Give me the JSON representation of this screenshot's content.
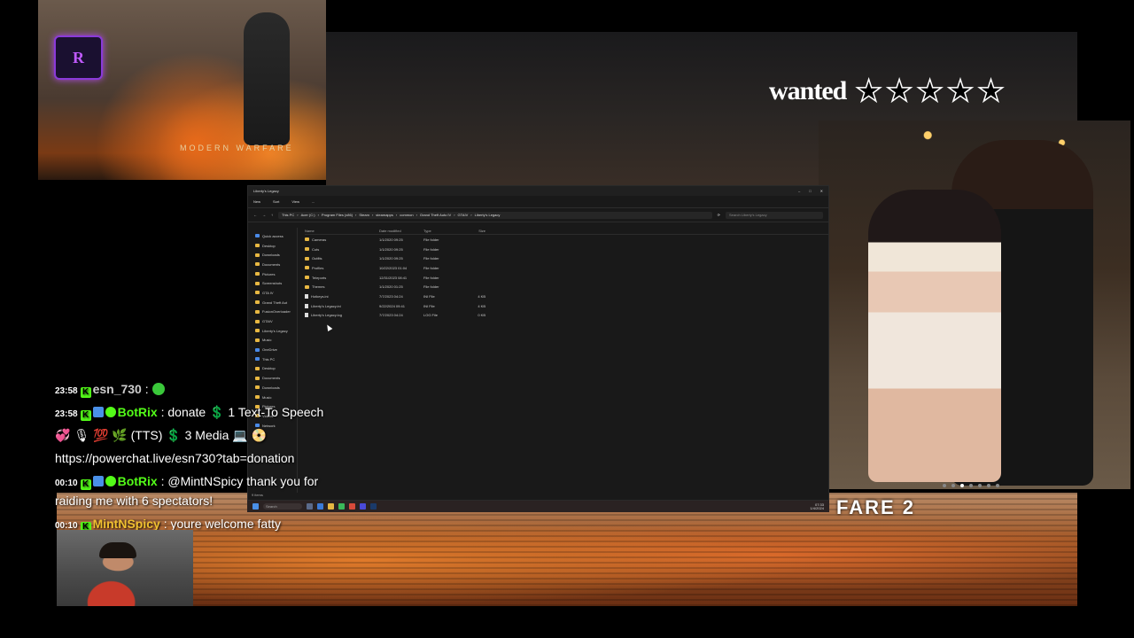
{
  "overlay": {
    "channel_logo_text": "R",
    "game_caption": "MODERN WARFARE",
    "mw_logo_text": "FARE 2",
    "wanted": {
      "label": "wanted",
      "stars_total": 5,
      "stars_lit": 0,
      "star_glyph": "★",
      "star_color": "#000000",
      "star_outline": "#ffffff"
    }
  },
  "explorer": {
    "title": "Liberty's Legacy",
    "toolbar": [
      "New",
      "Sort",
      "View",
      "..."
    ],
    "breadcrumb": [
      "This PC",
      "Acer (C:)",
      "Program Files (x86)",
      "Steam",
      "steamapps",
      "common",
      "Grand Theft Auto IV",
      "GTAIV",
      "Liberty's Legacy"
    ],
    "search_placeholder": "Search Liberty's Legacy",
    "nav": [
      {
        "label": "Quick access",
        "icon": "star-icon"
      },
      {
        "label": "Desktop",
        "icon": "folder-icon"
      },
      {
        "label": "Downloads",
        "icon": "folder-icon"
      },
      {
        "label": "Documents",
        "icon": "folder-icon"
      },
      {
        "label": "Pictures",
        "icon": "folder-icon"
      },
      {
        "label": "Screenshots",
        "icon": "folder-icon"
      },
      {
        "label": "GTA IV",
        "icon": "folder-icon"
      },
      {
        "label": "Grand Theft Aut",
        "icon": "folder-icon"
      },
      {
        "label": "FusionOverloader",
        "icon": "folder-icon"
      },
      {
        "label": "GTAIV",
        "icon": "folder-icon"
      },
      {
        "label": "Liberty's Legacy",
        "icon": "folder-icon"
      },
      {
        "label": "Music",
        "icon": "folder-icon"
      },
      {
        "label": "OneDrive",
        "icon": "cloud-icon"
      },
      {
        "label": "This PC",
        "icon": "pc-icon"
      },
      {
        "label": "Desktop",
        "icon": "folder-icon"
      },
      {
        "label": "Documents",
        "icon": "folder-icon"
      },
      {
        "label": "Downloads",
        "icon": "folder-icon"
      },
      {
        "label": "Music",
        "icon": "folder-icon"
      },
      {
        "label": "Pictures",
        "icon": "folder-icon"
      },
      {
        "label": "Videos",
        "icon": "folder-icon"
      },
      {
        "label": "Network",
        "icon": "network-icon"
      }
    ],
    "columns": [
      "Name",
      "Date modified",
      "Type",
      "Size"
    ],
    "rows": [
      {
        "name": "Cameras",
        "date": "1/1/2020 09:25",
        "type": "File folder",
        "size": "",
        "kind": "folder"
      },
      {
        "name": "Cuts",
        "date": "1/1/2020 09:25",
        "type": "File folder",
        "size": "",
        "kind": "folder"
      },
      {
        "name": "Outfits",
        "date": "1/1/2020 09:25",
        "type": "File folder",
        "size": "",
        "kind": "folder"
      },
      {
        "name": "Profiles",
        "date": "10/22/2023 01:04",
        "type": "File folder",
        "size": "",
        "kind": "folder"
      },
      {
        "name": "Teleports",
        "date": "12/31/2023 08:41",
        "type": "File folder",
        "size": "",
        "kind": "folder"
      },
      {
        "name": "Themes",
        "date": "1/1/2020 01:25",
        "type": "File folder",
        "size": "",
        "kind": "folder"
      },
      {
        "name": "Hotkeys.ini",
        "date": "7/7/2023 04:24",
        "type": "INI File",
        "size": "4 KB",
        "kind": "file"
      },
      {
        "name": "Liberty's Legacy.ini",
        "date": "9/22/2024 09:41",
        "type": "INI File",
        "size": "4 KB",
        "kind": "file"
      },
      {
        "name": "Liberty's Legacy.log",
        "date": "7/7/2023 04:24",
        "type": "LOG File",
        "size": "0 KB",
        "kind": "file"
      }
    ],
    "status": "9 items"
  },
  "taskbar": {
    "search_label": "Search",
    "time": "07:33",
    "date": "1/4/2024"
  },
  "chat": [
    {
      "time": "23:58",
      "badges": [
        "kick"
      ],
      "user": "esn_730",
      "user_color": "#cccccc",
      "text": "",
      "emote": "green-face-emote"
    },
    {
      "time": "23:58",
      "badges": [
        "kick",
        "bot",
        "verified"
      ],
      "user": "BotRix",
      "user_color": "#53fc18",
      "text": ": donate  💲  1 Text-To Speech"
    },
    {
      "time": "",
      "badges": [],
      "user": "",
      "user_color": "#ffffff",
      "text": "💞 🎙 💯 🌿 (TTS)  💲 3 Media 💻 📀"
    },
    {
      "time": "",
      "badges": [],
      "user": "",
      "user_color": "#ffffff",
      "text": "https://powerchat.live/esn730?tab=donation"
    },
    {
      "time": "00:10",
      "badges": [
        "kick",
        "bot",
        "verified"
      ],
      "user": "BotRix",
      "user_color": "#53fc18",
      "text": ": @MintNSpicy thank you for raiding me with 6 spectators!"
    },
    {
      "time": "00:10",
      "badges": [
        "kick"
      ],
      "user": "MintNSpicy",
      "user_color": "#f0c030",
      "text": ": youre welcome fatty"
    }
  ],
  "photo": {
    "dots_total": 7,
    "dots_active": 2
  }
}
